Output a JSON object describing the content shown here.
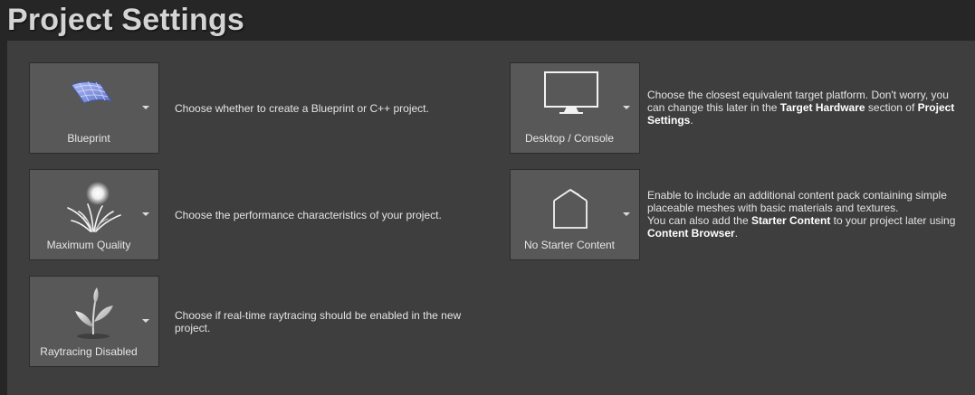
{
  "page": {
    "title": "Project Settings"
  },
  "settings": {
    "project_type": {
      "label": "Blueprint",
      "icon": "blueprint-icon",
      "description": "Choose whether to create a Blueprint or C++ project."
    },
    "quality": {
      "label": "Maximum Quality",
      "icon": "maximum-quality-icon",
      "description": "Choose the performance characteristics of your project."
    },
    "raytracing": {
      "label": "Raytracing Disabled",
      "icon": "raytracing-disabled-icon",
      "description": "Choose if real-time raytracing should be enabled in the new project."
    },
    "target_platform": {
      "label": "Desktop / Console",
      "icon": "desktop-monitor-icon",
      "description_part1": "Choose the closest equivalent target platform. Don't worry, you can change this later in the ",
      "description_bold1": "Target Hardware",
      "description_part2": " section of ",
      "description_bold2": "Project Settings",
      "description_part3": "."
    },
    "starter_content": {
      "label": "No Starter Content",
      "icon": "empty-box-icon",
      "description_line1": "Enable to include an additional content pack containing simple placeable meshes with basic materials and textures.",
      "description_part1": "You can also add the ",
      "description_bold1": "Starter Content",
      "description_part2": " to your project later using ",
      "description_bold2": "Content Browser",
      "description_part3": "."
    }
  },
  "colors": {
    "background": "#262626",
    "panel": "#3e3e3e",
    "tile": "#585858",
    "text": "#e4e4e4"
  }
}
